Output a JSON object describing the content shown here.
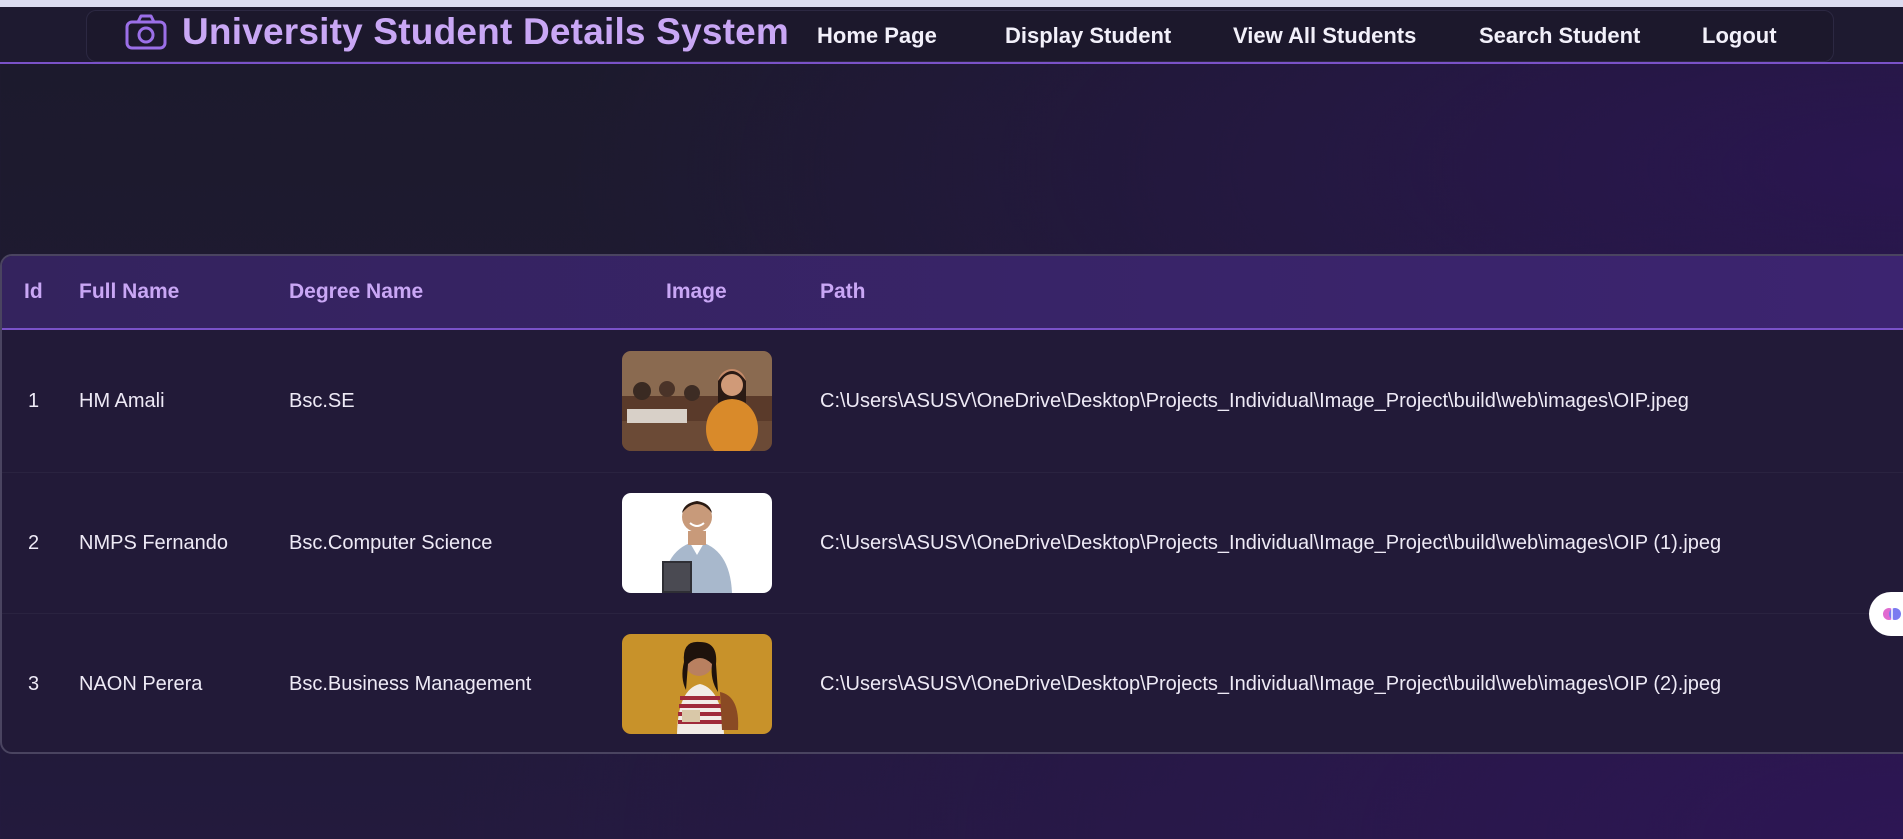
{
  "app": {
    "title": "University Student Details System",
    "icon": "camera-icon",
    "accent_color": "#c9a7f5",
    "border_color": "#7a52c8"
  },
  "nav": {
    "items": [
      {
        "label": "Home Page"
      },
      {
        "label": "Display Student"
      },
      {
        "label": "View All Students"
      },
      {
        "label": "Search Student"
      },
      {
        "label": "Logout"
      }
    ]
  },
  "table": {
    "headers": {
      "id": "Id",
      "full_name": "Full Name",
      "degree_name": "Degree Name",
      "image": "Image",
      "path": "Path"
    },
    "rows": [
      {
        "id": "1",
        "full_name": "HM Amali",
        "degree_name": "Bsc.SE",
        "image": "student-photo-classroom",
        "path": "C:\\Users\\ASUSV\\OneDrive\\Desktop\\Projects_Individual\\Image_Project\\build\\web\\images\\OIP.jpeg"
      },
      {
        "id": "2",
        "full_name": "NMPS Fernando",
        "degree_name": "Bsc.Computer Science",
        "image": "student-photo-white-bg",
        "path": "C:\\Users\\ASUSV\\OneDrive\\Desktop\\Projects_Individual\\Image_Project\\build\\web\\images\\OIP (1).jpeg"
      },
      {
        "id": "3",
        "full_name": "NAON Perera",
        "degree_name": "Bsc.Business Management",
        "image": "student-photo-orange-bg",
        "path": "C:\\Users\\ASUSV\\OneDrive\\Desktop\\Projects_Individual\\Image_Project\\build\\web\\images\\OIP (2).jpeg"
      }
    ]
  },
  "floating_widget": {
    "icon": "brain-icon"
  }
}
